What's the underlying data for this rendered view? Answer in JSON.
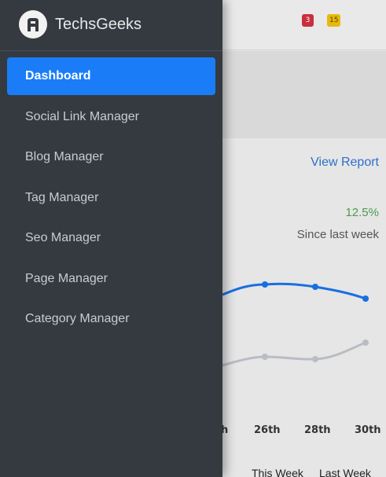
{
  "brand": {
    "name": "TechsGeeks",
    "logo": "app-logo-icon"
  },
  "topbar": {
    "badge_notifications": "3",
    "badge_messages": "15"
  },
  "sidebar": {
    "items": [
      {
        "label": "Dashboard",
        "active": true
      },
      {
        "label": "Social Link Manager",
        "active": false
      },
      {
        "label": "Blog Manager",
        "active": false
      },
      {
        "label": "Tag Manager",
        "active": false
      },
      {
        "label": "Seo Manager",
        "active": false
      },
      {
        "label": "Page Manager",
        "active": false
      },
      {
        "label": "Category Manager",
        "active": false
      }
    ]
  },
  "main": {
    "view_report": "View Report",
    "change_pct": "12.5%",
    "change_label": "Since last week",
    "legend_this": "This Week",
    "legend_last": "Last Week"
  },
  "chart_data": {
    "type": "line",
    "categories": [
      "h",
      "26th",
      "28th",
      "30th"
    ],
    "series": [
      {
        "name": "This Week",
        "values": [
          null,
          1,
          1,
          0.8
        ],
        "color": "#1a6fe0"
      },
      {
        "name": "Last Week",
        "values": [
          null,
          0.2,
          0.2,
          0.5
        ],
        "color": "#b9bdc3"
      }
    ]
  },
  "colors": {
    "accent": "#1a7df7",
    "drawer_bg": "#353a41",
    "success": "#4e9a4e",
    "link": "#2f6fc9"
  }
}
